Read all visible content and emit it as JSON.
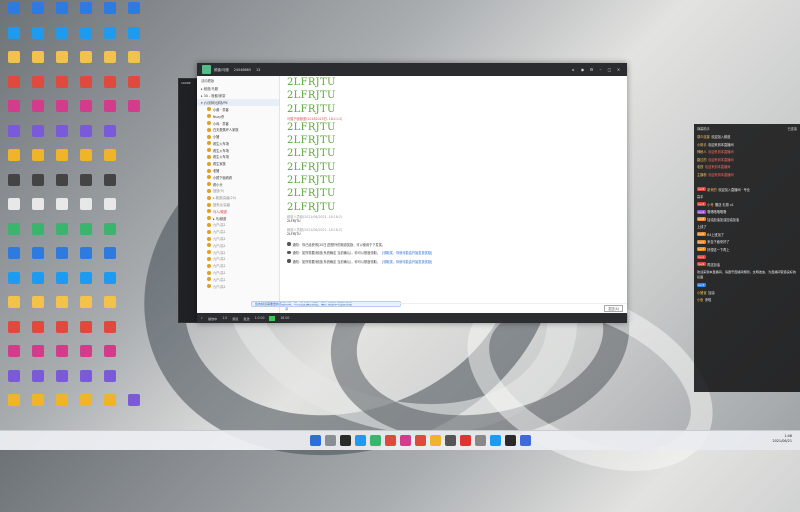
{
  "desktop": {
    "icons": [
      "",
      "",
      "",
      "",
      "",
      "",
      "",
      "",
      "",
      "",
      "",
      "",
      "",
      "",
      "",
      "",
      "",
      "",
      "",
      "",
      "",
      "",
      "",
      "",
      "",
      "",
      "",
      "",
      "",
      "",
      "",
      "",
      "",
      "",
      "",
      "",
      "",
      "",
      "",
      "",
      "",
      "",
      "",
      "",
      "",
      "",
      "",
      "",
      "",
      "",
      "",
      "",
      "",
      "",
      "",
      "",
      "",
      "",
      "",
      "",
      "",
      "",
      "",
      "",
      "",
      "",
      "",
      "",
      "",
      "",
      "",
      "",
      "",
      "",
      "",
      ""
    ]
  },
  "back_window": {
    "title": "1000P"
  },
  "chat_window": {
    "title_name": "频道/马服",
    "title_id": "24546865",
    "title_count": "13",
    "sidebar": {
      "header": "活动看版",
      "groups": [
        {
          "label": "▸ 频道/马服",
          "active": false
        },
        {
          "label": "▸ 30 - 啥都/家宴",
          "active": false
        },
        {
          "label": "▾ 六/剑网/战场/PK",
          "active": true
        }
      ],
      "rows": [
        {
          "label": "小酱 · 墨客",
          "style": ""
        },
        {
          "label": "Nuzy杀",
          "style": ""
        },
        {
          "label": "小鸡 · 墨客",
          "style": ""
        },
        {
          "label": "白天蛋蛋坏人家族",
          "style": ""
        },
        {
          "label": "小猪",
          "style": ""
        },
        {
          "label": "看生火车场",
          "style": ""
        },
        {
          "label": "看生火车场",
          "style": ""
        },
        {
          "label": "看生火车场",
          "style": ""
        },
        {
          "label": "看生家族",
          "style": ""
        },
        {
          "label": "老猪",
          "style": ""
        },
        {
          "label": "小顾下面看看",
          "style": ""
        },
        {
          "label": "看小头",
          "style": ""
        },
        {
          "label": "回放(9)",
          "style": "dim"
        },
        {
          "label": "▸ 频道/高级(20)",
          "style": "dim"
        },
        {
          "label": "回来点/高级",
          "style": "dim"
        },
        {
          "label": "马人/频道",
          "style": "red"
        },
        {
          "label": "▸ 马/频道",
          "style": ""
        },
        {
          "label": "九户/高1",
          "style": "dim"
        },
        {
          "label": "九户/高1",
          "style": "dim"
        },
        {
          "label": "九户/高1",
          "style": "dim"
        },
        {
          "label": "九户/高1",
          "style": "dim"
        },
        {
          "label": "九户/高1",
          "style": "dim"
        },
        {
          "label": "九户/高1",
          "style": "dim"
        },
        {
          "label": "九户/高1",
          "style": "dim"
        },
        {
          "label": "九户/高1",
          "style": "dim"
        },
        {
          "label": "九户/高1",
          "style": "dim"
        },
        {
          "label": "九户/高1",
          "style": "dim"
        }
      ]
    },
    "messages": {
      "top_lines": [
        "2LFRJTU",
        "2LFRJTU",
        "2LFRJTU"
      ],
      "meta_1": "马猫下面频道(20181025日. 18:11:2)",
      "mid_lines": [
        "2LFRJTU",
        "2LFRJTU",
        "2LFRJTU",
        "2LFRJTU",
        "2LFRJTU",
        "2LFRJTU",
        "2LFRJTU"
      ],
      "meta_2": "频道人员频(2021/06/2021. 18:18:2)",
      "small_1": "2LFRJTU",
      "meta_3": "频道人员频(2021/06/2021. 18:18:2)",
      "small_2": "2LFRJTU",
      "system": [
        {
          "text": "通知：你已经获得[20日]您额外的频道奖励，可以使用于下发奖。",
          "link": ""
        },
        {
          "text": "通知：如所需要/频道(系统确定 当前确认)，你可以额度领取。",
          "link": "[领取奖，你就可能会开始发放奖励]"
        },
        {
          "text": "通知：如所需要/频道(系统确定 当前确认)，你可以额度领取。",
          "link": "[领取奖，你就可能会开始发放奖励]"
        }
      ],
      "notice": "您的频道需要更新高级时间，可以点此确认按钮，确认 频道你可更新高级"
    },
    "input": {
      "placeholder": "",
      "send_label": "发送(S)"
    },
    "bottom": [
      "播放中",
      "1.0",
      "频道",
      "发送",
      "1:0  00",
      "18  00"
    ]
  },
  "overlay": {
    "header_left": "弹幕助手",
    "header_right": "已连接",
    "rows": [
      {
        "badge": "",
        "badge_color": "b-red",
        "name": "观众连接",
        "text": "欢迎加入频道",
        "hl": false
      },
      {
        "badge": "",
        "badge_color": "b-orange",
        "name": "小助手",
        "text": "欢迎来到本直播间",
        "hl": false
      },
      {
        "badge": "",
        "badge_color": "b-red",
        "name": "神秘人",
        "text": "欢迎来到本直播间",
        "hl": true
      },
      {
        "badge": "",
        "badge_color": "b-red",
        "name": "路过的",
        "text": "欢迎来到本直播间",
        "hl": true
      },
      {
        "badge": "",
        "badge_color": "b-red",
        "name": "老铁",
        "text": "欢迎来到本直播间",
        "hl": true
      },
      {
        "badge": "",
        "badge_color": "b-red",
        "name": "主播粉",
        "text": "欢迎来到本直播间",
        "hl": true
      },
      {
        "badge": "",
        "badge_color": "",
        "name": "",
        "text": "",
        "hl": false
      },
      {
        "badge": "Lv.5",
        "badge_color": "b-red",
        "name": "新来的",
        "text": "欢迎加入直播间 · 专业",
        "hl": false
      },
      {
        "badge": "",
        "badge_color": "",
        "name": "",
        "text": "高手",
        "hl": false
      },
      {
        "badge": "Lv.3",
        "badge_color": "b-red",
        "name": "小号",
        "text": "赠送 礼物 x1",
        "hl": false
      },
      {
        "badge": "Lv.2",
        "badge_color": "b-purple",
        "name": "",
        "text": "咯咯咯咯咯咯",
        "hl": false
      },
      {
        "badge": "Lv.8",
        "badge_color": "b-orange",
        "name": "",
        "text": "加油加油加油加油加油",
        "hl": false
      },
      {
        "badge": "",
        "badge_color": "",
        "name": "",
        "text": "上线了",
        "hl": false
      },
      {
        "badge": "Lv.6",
        "badge_color": "b-orange",
        "name": "",
        "text": "84上班加了",
        "hl": false
      },
      {
        "badge": "Lv.4",
        "badge_color": "b-orange",
        "name": "",
        "text": "来自下面来好了",
        "hl": false
      },
      {
        "badge": "Lv.7",
        "badge_color": "b-orange",
        "name": "",
        "text": "好想这一下再上",
        "hl": false
      },
      {
        "badge": "Lv.1",
        "badge_color": "b-red",
        "name": "",
        "text": "",
        "hl": false
      },
      {
        "badge": "Lv.9",
        "badge_color": "b-red",
        "name": "",
        "text": "再送加油",
        "hl": false
      }
    ],
    "notice": "欢迎来到本直播间，请遵守直播间规则，文明发言，为直播间营造良好的氛围",
    "tail_rows": [
      {
        "badge": "Lv.3",
        "badge_color": "b-blue",
        "name": "",
        "text": "",
        "hl": false
      },
      {
        "badge": "",
        "badge_color": "",
        "name": "小猪宝",
        "text": "加油",
        "hl": false
      },
      {
        "badge": "",
        "badge_color": "",
        "name": "小鱼",
        "text": "来啦",
        "hl": false
      }
    ]
  },
  "taskbar": {
    "time": "1:46",
    "date": "2021/06/21"
  }
}
